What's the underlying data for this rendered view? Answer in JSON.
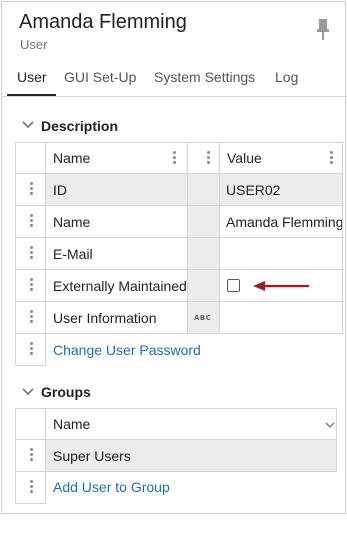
{
  "header": {
    "title": "Amanda Flemming",
    "subtitle": "User"
  },
  "tabs": [
    {
      "label": "User",
      "active": true
    },
    {
      "label": "GUI Set-Up",
      "active": false
    },
    {
      "label": "System Settings",
      "active": false
    },
    {
      "label": "Log",
      "active": false
    }
  ],
  "description": {
    "heading": "Description",
    "columns": {
      "name": "Name",
      "value": "Value"
    },
    "rows": [
      {
        "name": "ID",
        "value": "USER02"
      },
      {
        "name": "Name",
        "value": "Amanda Flemming"
      },
      {
        "name": "E-Mail",
        "value": ""
      },
      {
        "name": "Externally Maintained",
        "value": ""
      },
      {
        "name": "User Information",
        "value": "",
        "type_icon": "ABC"
      }
    ],
    "externally_maintained_checked": false,
    "change_password_link": "Change User Password"
  },
  "groups": {
    "heading": "Groups",
    "column": "Name",
    "rows": [
      {
        "name": "Super Users"
      }
    ],
    "add_link": "Add User to Group"
  },
  "colors": {
    "link": "#1c6fb3",
    "arrow": "#a01c24",
    "shaded_cell": "#ececec"
  }
}
